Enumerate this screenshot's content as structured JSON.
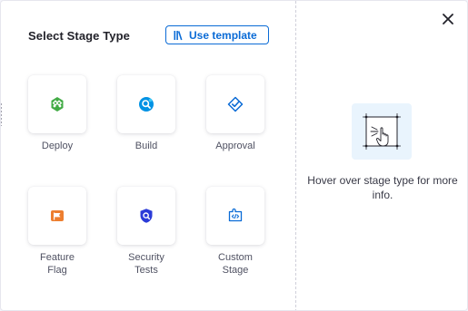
{
  "dialog": {
    "title": "Select Stage Type",
    "template_button_label": "Use template",
    "close_icon": "close-icon",
    "template_icon": "template-library-icon"
  },
  "stages": [
    {
      "label_lines": [
        "Deploy"
      ],
      "icon": "deploy-icon",
      "color": "#42ab45"
    },
    {
      "label_lines": [
        "Build"
      ],
      "icon": "build-icon",
      "color": "#0092e4"
    },
    {
      "label_lines": [
        "Approval"
      ],
      "icon": "approval-icon",
      "color": "#0a6bd6"
    },
    {
      "label_lines": [
        "Feature",
        "Flag"
      ],
      "icon": "feature-flag-icon",
      "color": "#ed7e2f"
    },
    {
      "label_lines": [
        "Security",
        "Tests"
      ],
      "icon": "security-tests-icon",
      "color": "#2b3bd8"
    },
    {
      "label_lines": [
        "Custom",
        "Stage"
      ],
      "icon": "custom-stage-icon",
      "color": "#0a6bd6"
    }
  ],
  "info_panel": {
    "text": "Hover over stage type for more info.",
    "icon": "hover-pointer-illustration"
  },
  "colors": {
    "accent": "#0a6bd6",
    "text": "#22222a",
    "muted": "#4f5162"
  }
}
